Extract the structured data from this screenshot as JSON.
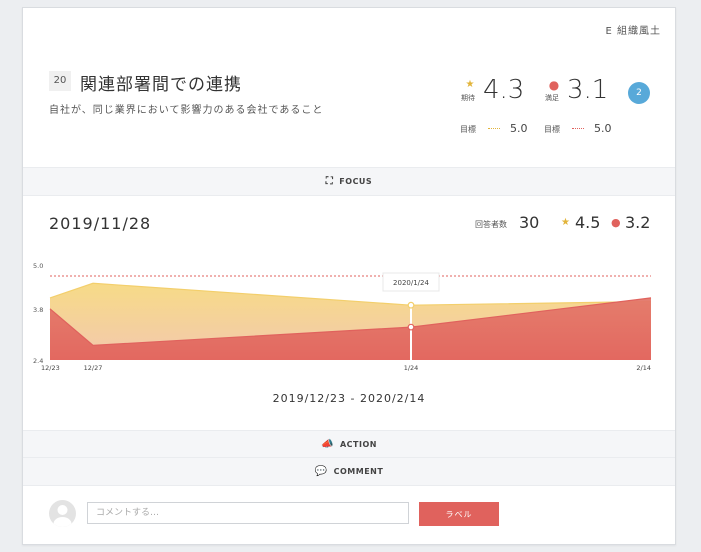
{
  "category": "E 組織風土",
  "item": {
    "number": "20",
    "title": "関連部署間での連携",
    "description": "自社が、同じ業界において影響力のある会社であること"
  },
  "metrics": {
    "expectation": {
      "label": "期待",
      "value": "4.3",
      "goal_label": "目標",
      "goal_value": "5.0",
      "color": "#e2b43a"
    },
    "satisfaction": {
      "label": "満足",
      "value": "3.1",
      "goal_label": "目標",
      "goal_value": "5.0",
      "color": "#e0625d"
    },
    "badge": "2"
  },
  "sections": {
    "focus": "FOCUS",
    "action": "ACTION",
    "comment": "COMMENT"
  },
  "summary": {
    "date": "2019/11/28",
    "respondents_label": "回答者数",
    "respondents": "30",
    "expectation": "4.5",
    "satisfaction": "3.2"
  },
  "chart_data": {
    "type": "area",
    "x": [
      "12/23",
      "12/27",
      "1/24",
      "2/14"
    ],
    "ylim": [
      2.4,
      5.0
    ],
    "yticks": [
      "5.0",
      "3.8",
      "2.4"
    ],
    "series": [
      {
        "name": "期待",
        "values": [
          4.1,
          4.5,
          3.9,
          4.0
        ],
        "color": "#f3cf6c"
      },
      {
        "name": "満足",
        "values": [
          3.8,
          2.8,
          3.3,
          4.1
        ],
        "color": "#e0625d"
      }
    ],
    "goal": 4.7,
    "tooltip": "2020/1/24"
  },
  "date_range": "2019/12/23 - 2020/2/14",
  "comment_box": {
    "placeholder": "コメントする…",
    "button": "ラベル"
  }
}
